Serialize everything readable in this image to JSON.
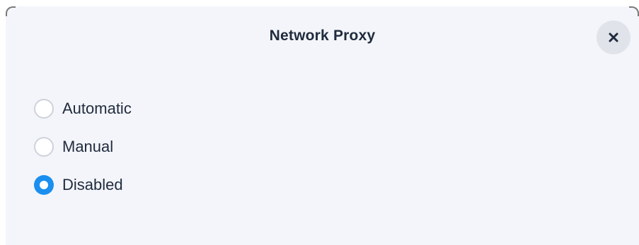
{
  "dialog": {
    "title": "Network Proxy",
    "close_icon": "close-icon"
  },
  "proxy": {
    "options": [
      {
        "label": "Automatic",
        "checked": false
      },
      {
        "label": "Manual",
        "checked": false
      },
      {
        "label": "Disabled",
        "checked": true
      }
    ],
    "selected": "Disabled"
  },
  "colors": {
    "background": "#f4f5fa",
    "accent": "#1a8ff0",
    "text": "#1f2b3d",
    "close_button_bg": "#e1e3ea"
  }
}
